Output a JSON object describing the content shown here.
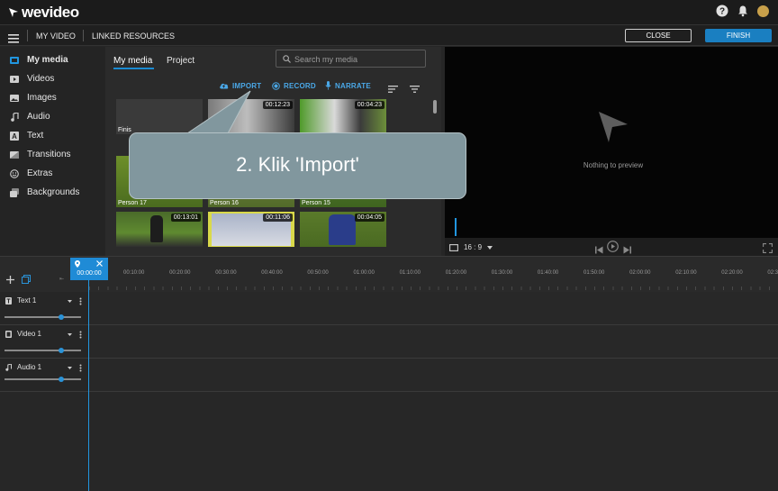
{
  "brand": {
    "logo_text": "wevideo",
    "accent": "#1a8bd3"
  },
  "topbar": {
    "icons": [
      "help-icon",
      "bell-icon",
      "avatar"
    ]
  },
  "menubar": {
    "my_video": "MY VIDEO",
    "linked_resources": "LINKED RESOURCES",
    "close_label": "CLOSE",
    "finish_label": "FINISH"
  },
  "sidebar": {
    "items": [
      {
        "label": "My media",
        "icon": "my-media-icon",
        "active": true
      },
      {
        "label": "Videos",
        "icon": "video-icon"
      },
      {
        "label": "Images",
        "icon": "image-icon"
      },
      {
        "label": "Audio",
        "icon": "music-note-icon"
      },
      {
        "label": "Text",
        "icon": "text-icon"
      },
      {
        "label": "Transitions",
        "icon": "transition-icon"
      },
      {
        "label": "Extras",
        "icon": "smiley-icon"
      },
      {
        "label": "Backgrounds",
        "icon": "backgrounds-icon"
      }
    ]
  },
  "media": {
    "tabs": [
      "My media",
      "Project"
    ],
    "search_placeholder": "Search my media",
    "actions": {
      "import": "IMPORT",
      "record": "RECORD",
      "narrate": "NARRATE"
    },
    "thumbs": [
      {
        "duration": "",
        "name": "Finis"
      },
      {
        "duration": "00:12:23",
        "name": ""
      },
      {
        "duration": "00:04:23",
        "name": ""
      },
      {
        "duration": "",
        "name": "Person 17"
      },
      {
        "duration": "",
        "name": "Person 16"
      },
      {
        "duration": "",
        "name": "Person 15"
      },
      {
        "duration": "00:13:01",
        "name": ""
      },
      {
        "duration": "00:11:06",
        "name": ""
      },
      {
        "duration": "00:04:05",
        "name": ""
      }
    ]
  },
  "callout": {
    "text": "2. Klik 'Import'"
  },
  "preview": {
    "empty_text": "Nothing to preview",
    "aspect": "16 : 9"
  },
  "timeline": {
    "playhead_time": "00:00:00",
    "ticks": [
      "00:10:00",
      "00:20:00",
      "00:30:00",
      "00:40:00",
      "00:50:00",
      "01:00:00",
      "01:10:00",
      "01:20:00",
      "01:30:00",
      "01:40:00",
      "01:50:00",
      "02:00:00",
      "02:10:00",
      "02:20:00",
      "02:3"
    ],
    "tracks": [
      {
        "name": "Text 1",
        "icon": "text-track-icon",
        "volume": 0.75
      },
      {
        "name": "Video 1",
        "icon": "video-track-icon",
        "volume": 0.75
      },
      {
        "name": "Audio 1",
        "icon": "audio-track-icon",
        "volume": 0.75
      }
    ]
  }
}
